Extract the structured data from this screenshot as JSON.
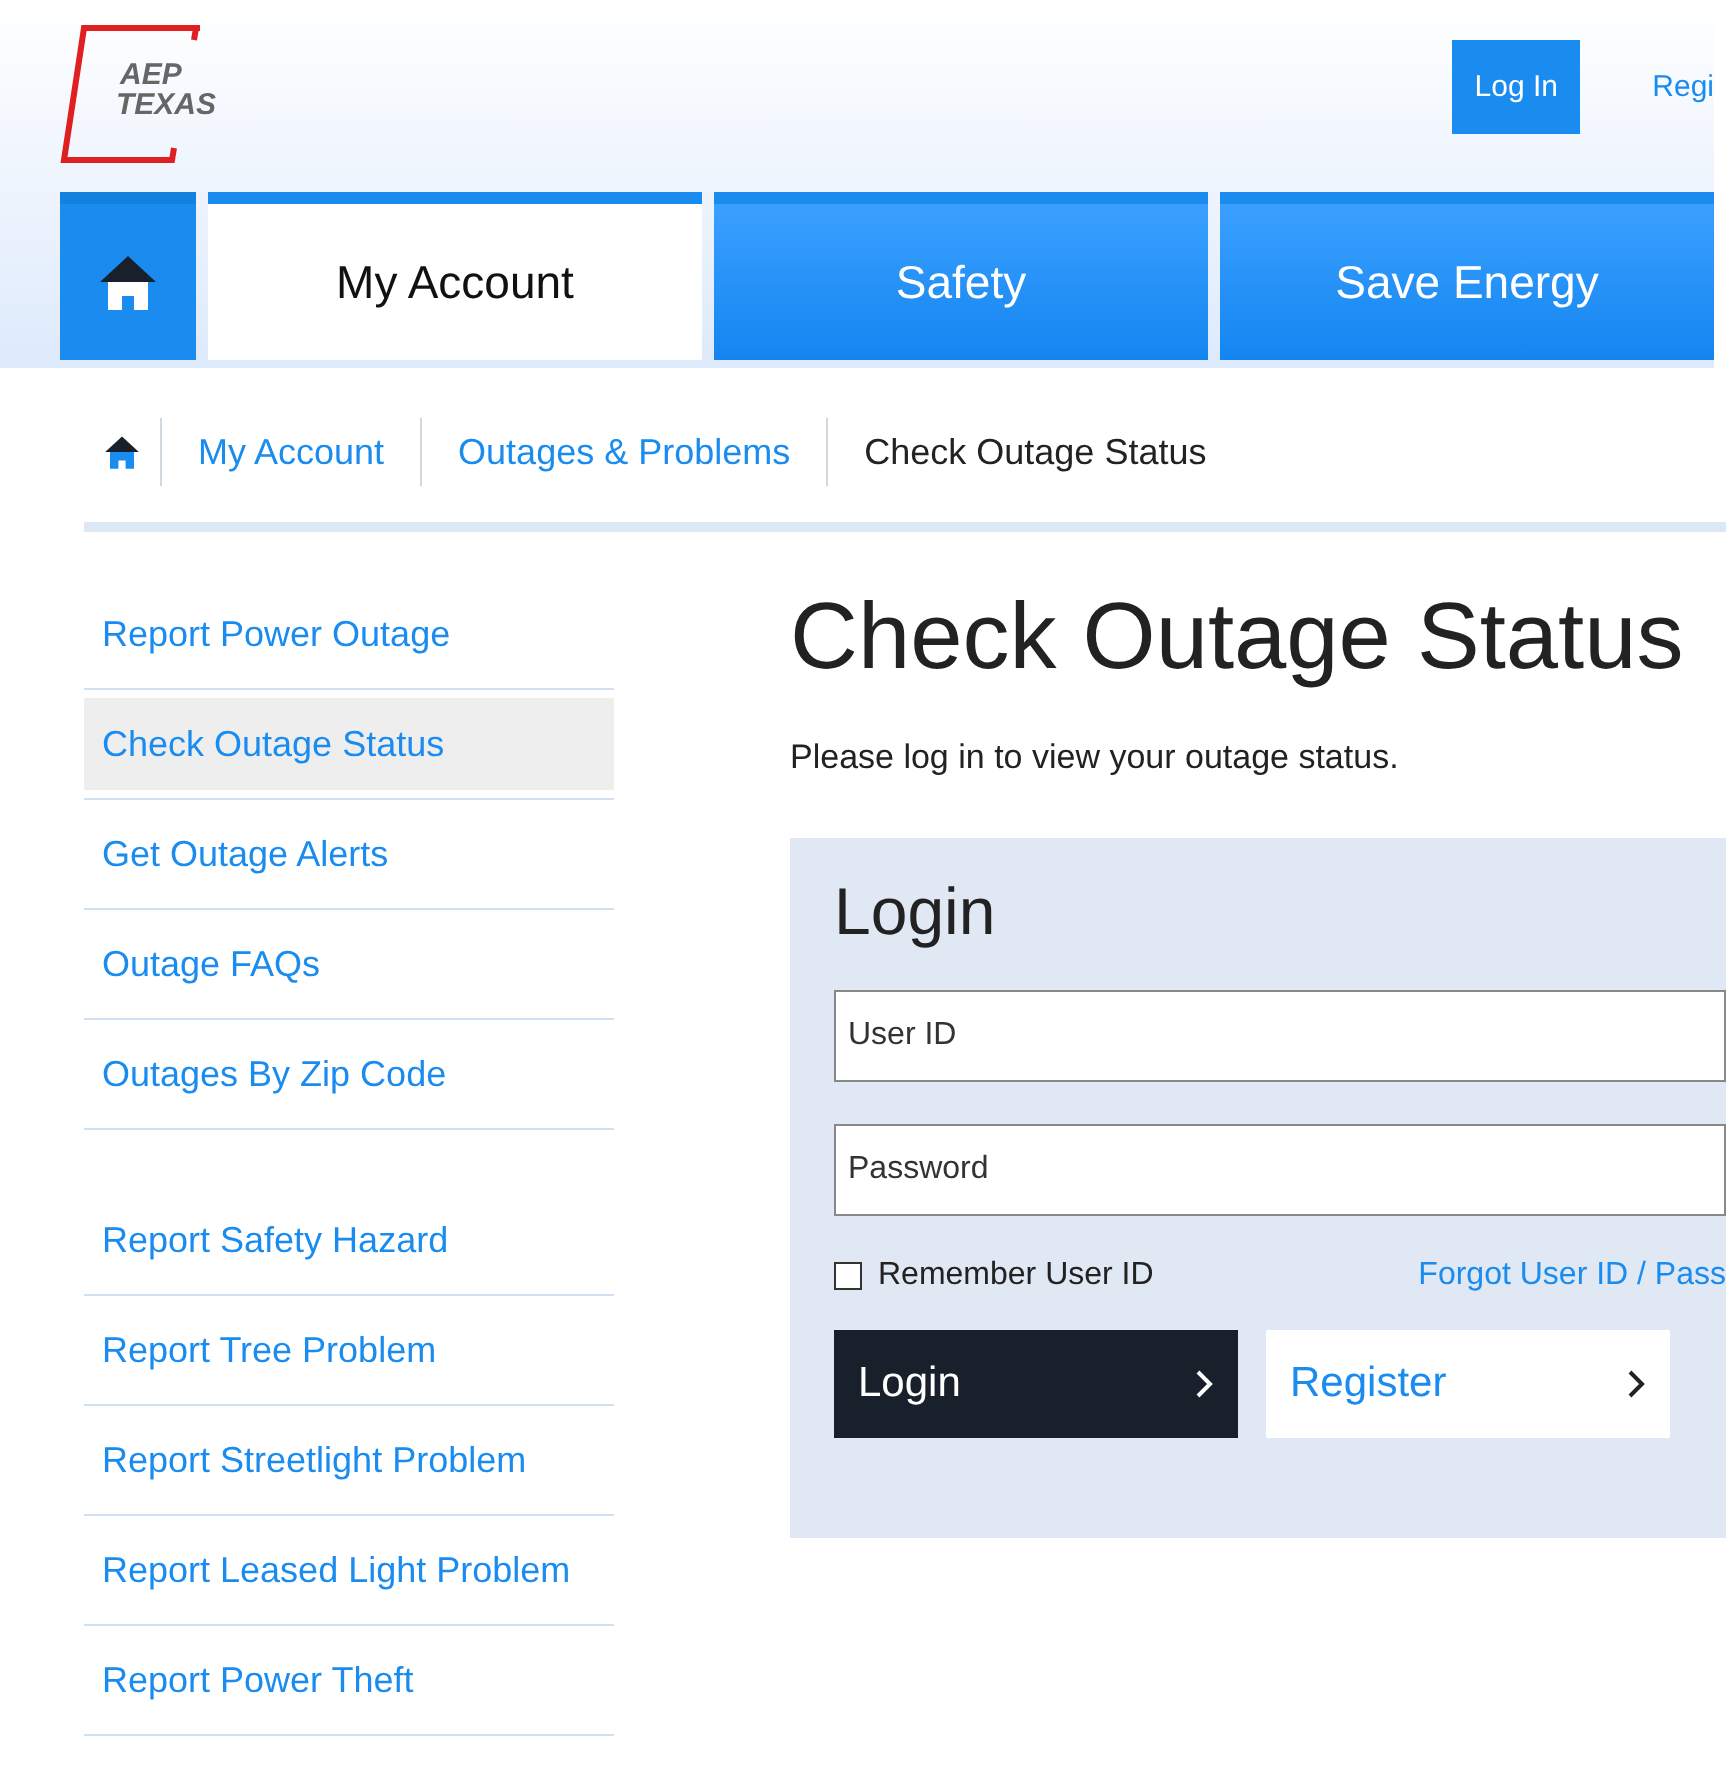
{
  "header": {
    "logo_lines": [
      "AEP",
      "TEXAS"
    ],
    "login_button": "Log In",
    "register_link": "Regi"
  },
  "nav": {
    "tabs": [
      {
        "label": "My Account",
        "selected": true
      },
      {
        "label": "Safety",
        "selected": false
      },
      {
        "label": "Save Energy",
        "selected": false
      }
    ]
  },
  "breadcrumb": [
    "My Account",
    "Outages & Problems",
    "Check Outage Status"
  ],
  "sidebar": {
    "groups": [
      [
        {
          "label": "Report Power Outage",
          "selected": false
        },
        {
          "label": "Check Outage Status",
          "selected": true
        },
        {
          "label": "Get Outage Alerts",
          "selected": false
        },
        {
          "label": "Outage FAQs",
          "selected": false
        },
        {
          "label": "Outages By Zip Code",
          "selected": false
        }
      ],
      [
        {
          "label": "Report Safety Hazard",
          "selected": false
        },
        {
          "label": "Report Tree Problem",
          "selected": false
        },
        {
          "label": "Report Streetlight Problem",
          "selected": false
        },
        {
          "label": "Report Leased Light Problem",
          "selected": false
        },
        {
          "label": "Report Power Theft",
          "selected": false
        }
      ]
    ]
  },
  "main": {
    "title": "Check Outage Status",
    "intro": "Please log in to view your outage status.",
    "login": {
      "title": "Login",
      "user_id": {
        "placeholder": "User ID"
      },
      "password": {
        "placeholder": "Password"
      },
      "remember": {
        "label": "Remember User ID",
        "checked": false
      },
      "forgot_link": "Forgot User ID / Pass",
      "buttons": [
        {
          "label": "Login",
          "kind": "primary"
        },
        {
          "label": "Register",
          "kind": "secondary"
        }
      ]
    }
  }
}
